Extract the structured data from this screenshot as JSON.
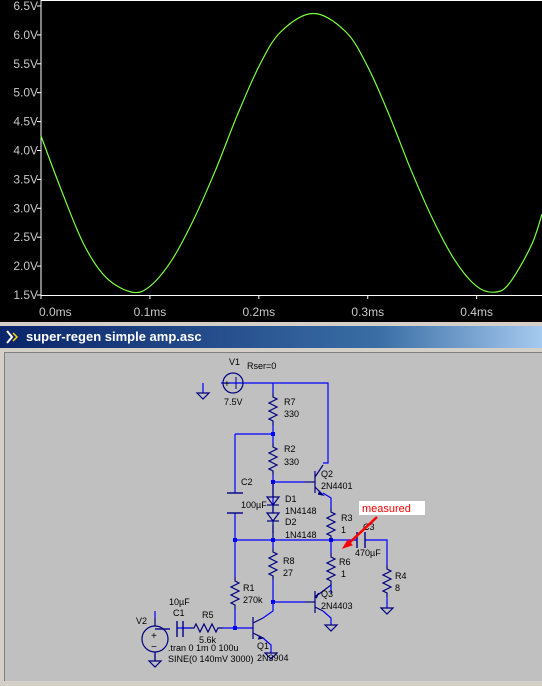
{
  "plot": {
    "y_ticks": [
      "6.5V",
      "6.0V",
      "5.5V",
      "5.0V",
      "4.5V",
      "4.0V",
      "3.5V",
      "3.0V",
      "2.5V",
      "2.0V",
      "1.5V"
    ],
    "x_ticks": [
      "0.0ms",
      "0.1ms",
      "0.2ms",
      "0.3ms",
      "0.4ms"
    ],
    "trace_color": "#7cff3a"
  },
  "chart_data": {
    "type": "line",
    "title": "",
    "xlabel": "",
    "ylabel": "",
    "xlim": [
      0.0,
      0.46
    ],
    "ylim": [
      1.5,
      6.5
    ],
    "x_ticks": [
      "0.0ms",
      "0.1ms",
      "0.2ms",
      "0.3ms",
      "0.4ms"
    ],
    "y_ticks": [
      "6.5V",
      "6.0V",
      "5.5V",
      "5.0V",
      "4.5V",
      "4.0V",
      "3.5V",
      "3.0V",
      "2.5V",
      "2.0V",
      "1.5V"
    ],
    "grid": false,
    "series": [
      {
        "color": "#7cff3a",
        "x": [
          0.0,
          0.02,
          0.04,
          0.06,
          0.0833,
          0.1,
          0.12,
          0.14,
          0.16,
          0.18,
          0.2,
          0.22,
          0.25,
          0.28,
          0.3,
          0.32,
          0.34,
          0.36,
          0.38,
          0.4,
          0.4167,
          0.43,
          0.45,
          0.46
        ],
        "y": [
          4.25,
          3.25,
          2.35,
          1.8,
          1.55,
          1.65,
          2.1,
          2.8,
          3.65,
          4.6,
          5.45,
          6.05,
          6.37,
          6.05,
          5.45,
          4.6,
          3.65,
          2.8,
          2.1,
          1.65,
          1.55,
          1.7,
          2.35,
          2.9
        ]
      }
    ]
  },
  "schematic": {
    "window_title": "super-regen simple amp.asc",
    "labels": {
      "v1": "V1",
      "rser": "Rser=0",
      "v1_val": "7.5V",
      "r7": "R7",
      "r7_val": "330",
      "r2": "R2",
      "r2_val": "330",
      "c2": "C2",
      "c2_val": "100µF",
      "d1": "D1",
      "d1_val": "1N4148",
      "d2": "D2",
      "d2_val": "1N4148",
      "q2": "Q2",
      "q2_val": "2N4401",
      "r3": "R3",
      "r3_val": "1",
      "c3": "C3",
      "c3_val": "470µF",
      "r6": "R6",
      "r6_val": "1",
      "r8": "R8",
      "r8_val": "27",
      "r4": "R4",
      "r4_val": "8",
      "r1": "R1",
      "r1_val": "270k",
      "q3": "Q3",
      "q3_val": "2N4403",
      "q1": "Q1",
      "q1_val": "2N3904",
      "c1_val": "10µF",
      "c1": "C1",
      "r5": "R5",
      "r5_val": "5.6k",
      "v2": "V2",
      "tran": ".tran 0 1m 0 100u",
      "sine": "SINE(0 140mV 3000)",
      "measured": "measured",
      "plus": "+",
      "minus": "−"
    },
    "colors": {
      "wire": "#0000ff",
      "component": "#000080",
      "annotation": "#ff0000"
    }
  }
}
